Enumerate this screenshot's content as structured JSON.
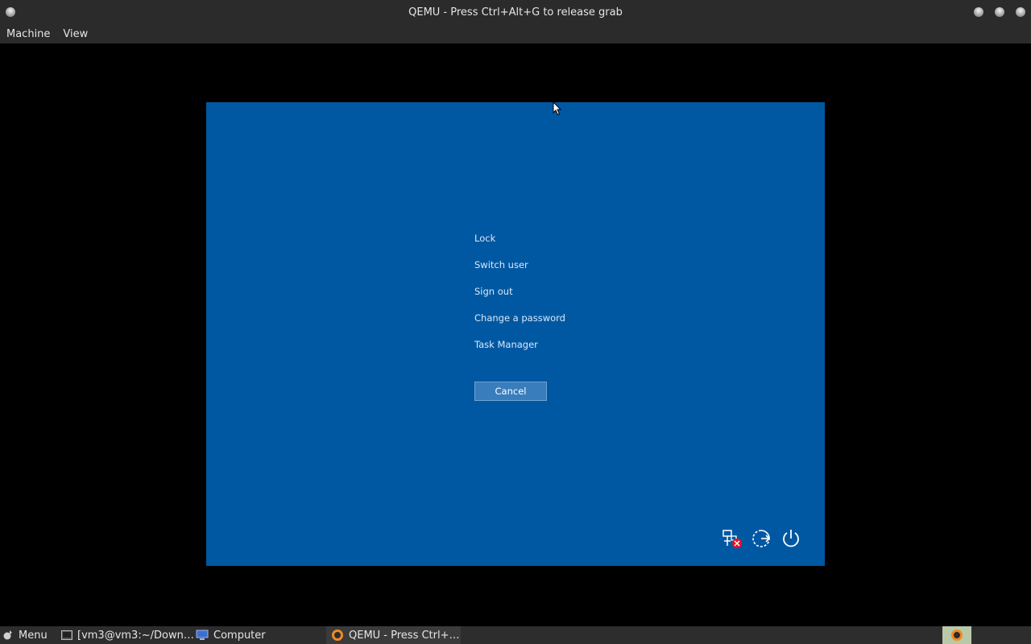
{
  "window": {
    "title": "QEMU - Press Ctrl+Alt+G to release grab"
  },
  "menubar": {
    "items": [
      "Machine",
      "View"
    ]
  },
  "guest_screen": {
    "background": "#0058a3",
    "options": [
      "Lock",
      "Switch user",
      "Sign out",
      "Change a password",
      "Task Manager"
    ],
    "cancel_label": "Cancel",
    "bottom_icons": [
      "network-disconnected-icon",
      "ease-of-access-icon",
      "power-icon"
    ]
  },
  "taskbar": {
    "menu_label": "Menu",
    "items": [
      {
        "label": "[vm3@vm3:~/Down…",
        "icon": "terminal-icon"
      },
      {
        "label": "Computer",
        "icon": "computer-icon"
      },
      {
        "label": "QEMU - Press Ctrl+…",
        "icon": "qemu-icon",
        "active": true
      }
    ],
    "tray_icon": "qemu-tray-icon"
  }
}
